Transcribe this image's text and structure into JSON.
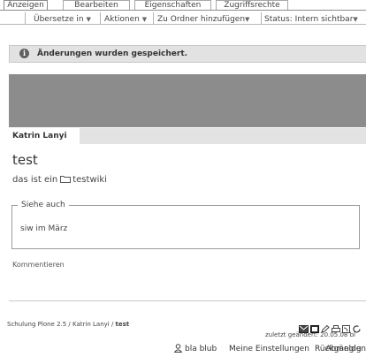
{
  "tabs": [
    "Anzeigen",
    "Bearbeiten",
    "Eigenschaften",
    "Zugriffsrechte"
  ],
  "actions": {
    "translate": "Übersetze in",
    "actions": "Aktionen",
    "add_folder": "Zu Ordner hinzufügen",
    "status": "Status: Intern sichtbar"
  },
  "message": {
    "icon": "info-icon",
    "text": "Änderungen wurden gespeichert."
  },
  "author_tab": "Katrin Lanyi",
  "content": {
    "title": "test",
    "description_prefix": "das ist ein",
    "description_link": "testwiki",
    "see_also_legend": "Siehe auch",
    "see_also_link": "siw im März",
    "comment": "Kommentieren"
  },
  "footer": {
    "breadcrumbs": [
      "Schulung Plone 2.5",
      "Katrin Lanyi",
      "test"
    ],
    "breadcrumb_sep": " / ",
    "modified": "zuletzt geändert: 20.05.08 bl"
  },
  "personal_bar": {
    "user": "bla blub",
    "settings": "Meine Einstellungen",
    "undo": "Rückgängig",
    "logout": "Abmelden"
  },
  "colors": {
    "banner": "#8c8c8c",
    "message_bg": "#e2e2e2",
    "author_bar": "#e3e3e3"
  }
}
